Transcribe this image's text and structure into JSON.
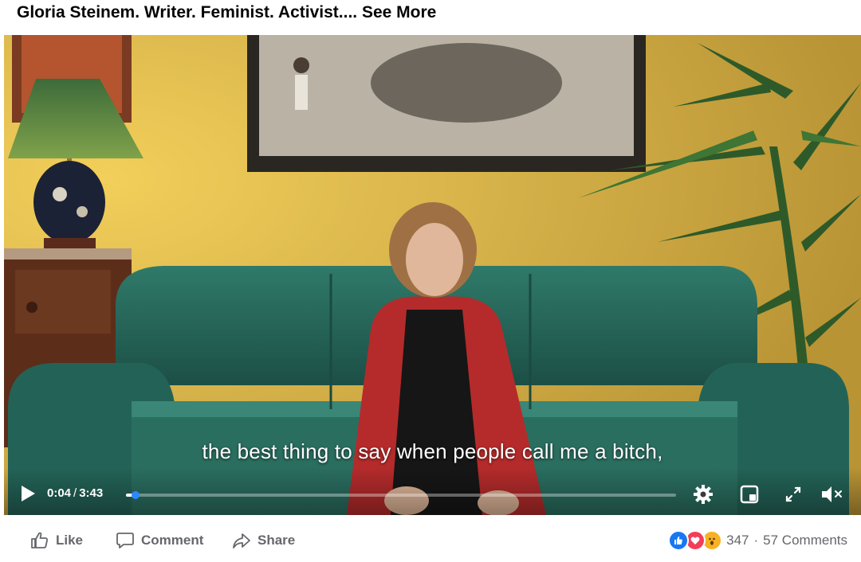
{
  "post": {
    "caption_text": "Gloria Steinem. Writer. Feminist. Activist....",
    "see_more_label": "See More"
  },
  "video": {
    "subtitle": "the best thing to say when people call me a bitch,",
    "current_time": "0:04",
    "duration": "3:43",
    "progress_fraction": 0.018,
    "play_icon": "play-icon",
    "settings_icon": "gear-icon",
    "pip_icon": "picture-in-picture-icon",
    "fullscreen_icon": "expand-icon",
    "mute_icon": "speaker-muted-icon"
  },
  "actions": {
    "like_label": "Like",
    "comment_label": "Comment",
    "share_label": "Share"
  },
  "stats": {
    "reaction_icons": [
      "like-reaction-icon",
      "love-reaction-icon",
      "wow-reaction-icon"
    ],
    "reaction_count": "347",
    "separator": "·",
    "comments_label": "57 Comments"
  },
  "colors": {
    "accent": "#1877f2",
    "love": "#f33e58",
    "wow": "#f7b125",
    "secondary_text": "#65676b"
  }
}
